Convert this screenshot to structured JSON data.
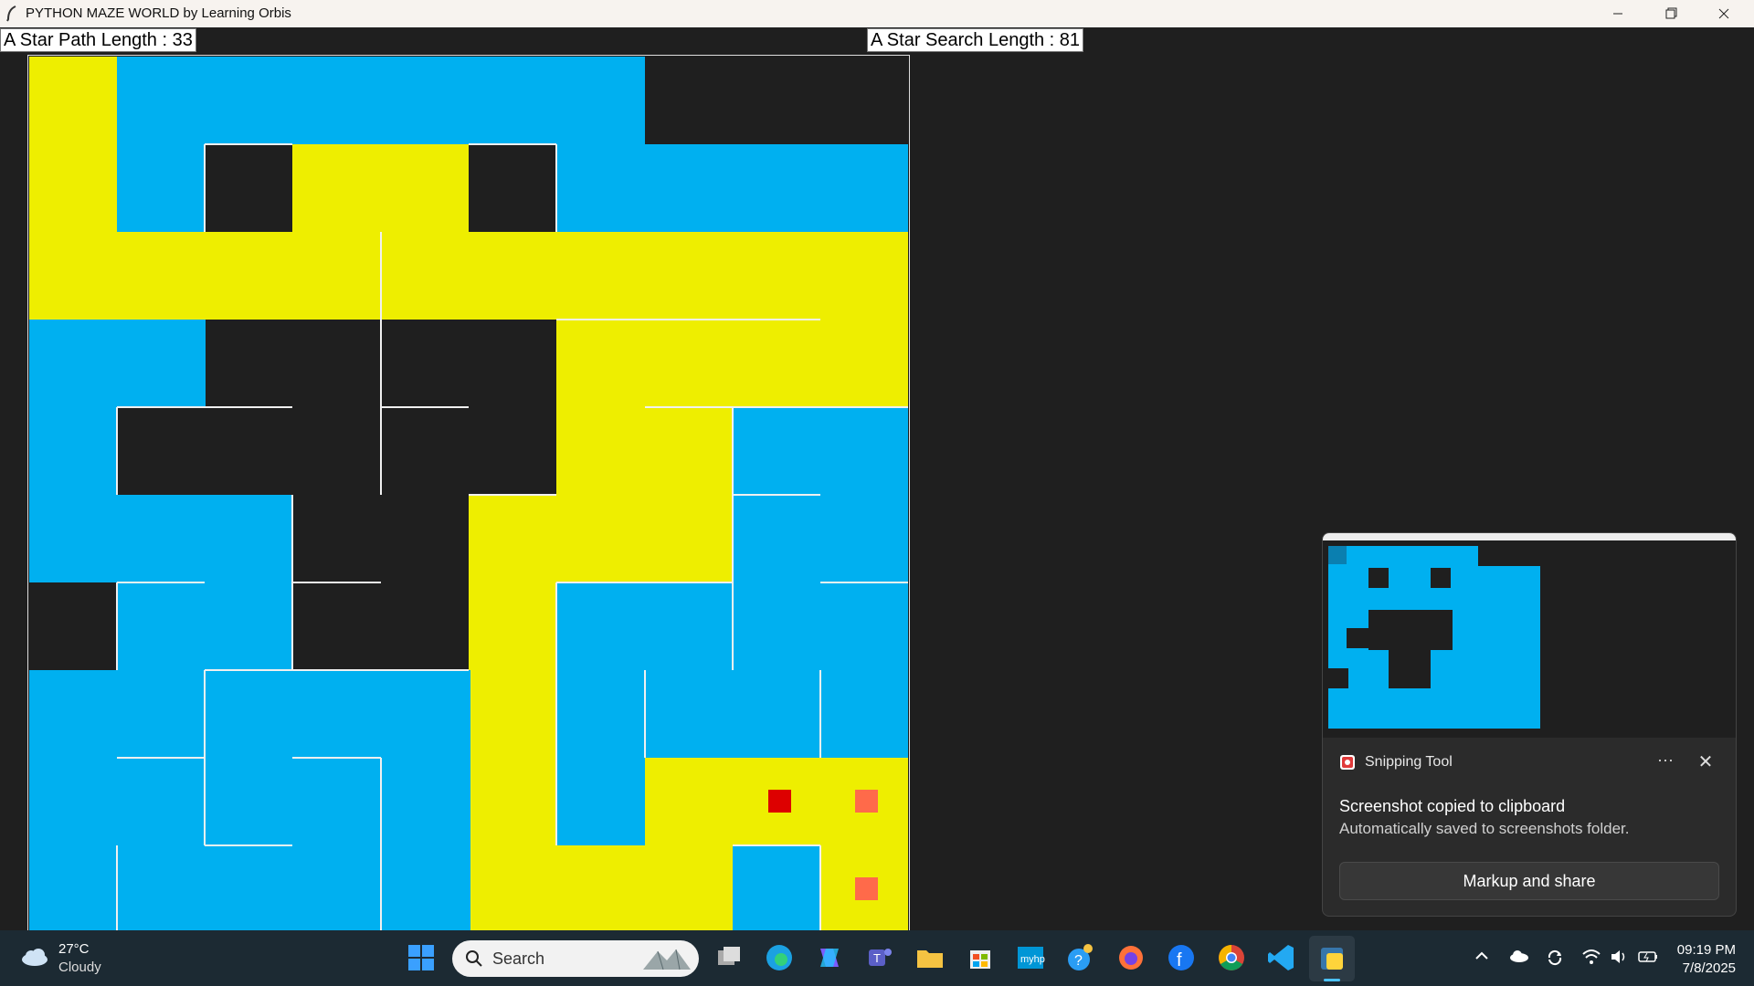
{
  "window": {
    "title": "PYTHON MAZE WORLD by Learning Orbis",
    "minimize_label": "—",
    "restore_label": "❐",
    "close_label": "✕"
  },
  "labels": {
    "path_length": "A Star Path Length : 33",
    "search_length": "A Star Search Length : 81"
  },
  "colors": {
    "wall": "#1f1f1f",
    "searched": "#00b0f0",
    "path": "#eeee00",
    "goal": "#dd0000",
    "agent": "#ff6a4a"
  },
  "snipping": {
    "app_name": "Snipping Tool",
    "more_label": "···",
    "close_label": "✕",
    "message": "Screenshot copied to clipboard",
    "detail": "Automatically saved to screenshots folder.",
    "action": "Markup and share"
  },
  "taskbar": {
    "weather_temp": "27°C",
    "weather_desc": "Cloudy",
    "search_placeholder": "Search",
    "time": "09:19 PM",
    "date": "7/8/2025",
    "apps": [
      "start-icon",
      "task-view-icon",
      "edge-icon",
      "copilot-icon",
      "teams-icon",
      "file-explorer-icon",
      "store-icon",
      "myhp-icon",
      "help-icon",
      "firefox-icon",
      "facebook-icon",
      "chrome-icon",
      "vscode-icon",
      "python-icon"
    ]
  }
}
